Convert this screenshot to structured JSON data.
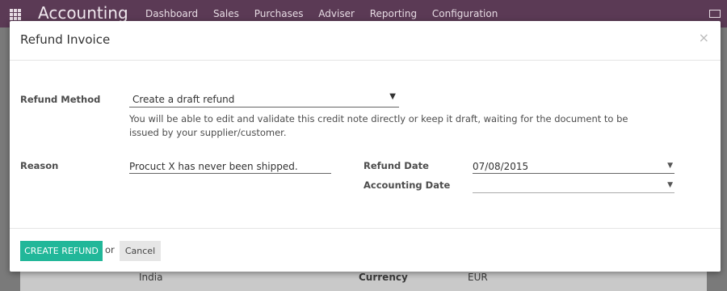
{
  "app": {
    "title": "Accounting",
    "nav": [
      "Dashboard",
      "Sales",
      "Purchases",
      "Adviser",
      "Reporting",
      "Configuration"
    ],
    "background_row": {
      "country": "India",
      "currency_label": "Currency",
      "currency_value": "EUR"
    }
  },
  "dialog": {
    "title": "Refund Invoice",
    "close_symbol": "×",
    "refund_method": {
      "label": "Refund Method",
      "value": "Create a draft refund",
      "help": "You will be able to edit and validate this credit note directly or keep it draft, waiting for the document to be issued by your supplier/customer."
    },
    "reason": {
      "label": "Reason",
      "value": "Procuct X has never been shipped."
    },
    "refund_date": {
      "label": "Refund Date",
      "value": "07/08/2015"
    },
    "accounting_date": {
      "label": "Accounting Date",
      "value": ""
    },
    "footer": {
      "create_label": "CREATE REFUND",
      "or_text": "or",
      "cancel_label": "Cancel"
    }
  },
  "colors": {
    "primary": "#21b799",
    "topbar": "#5b3a55"
  }
}
